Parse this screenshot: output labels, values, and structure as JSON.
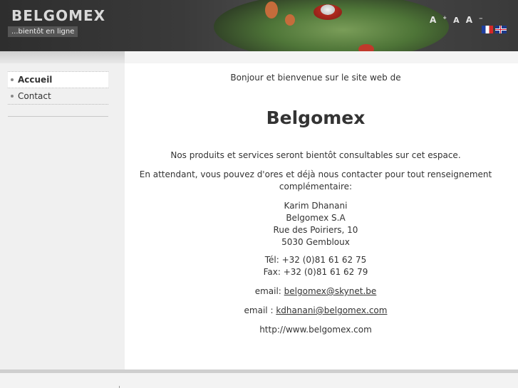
{
  "header": {
    "site_title": "BELGOMEX",
    "slogan": "...bientôt en ligne",
    "font_controls": {
      "increase": "A",
      "increase_sign": "+",
      "normal": "A",
      "decrease": "A",
      "decrease_sign": "−"
    },
    "languages": [
      "fr",
      "en"
    ]
  },
  "nav": {
    "items": [
      {
        "label": "Accueil",
        "active": true
      },
      {
        "label": "Contact",
        "active": false
      }
    ]
  },
  "content": {
    "intro": "Bonjour et bienvenue sur le site web de",
    "company": "Belgomex",
    "products": "Nos produits et services seront bientôt consultables sur cet espace.",
    "waiting": "En attendant, vous pouvez d'ores et déjà nous contacter pour tout renseignement complémentaire:",
    "address": {
      "name": "Karim Dhanani",
      "company": "Belgomex S.A",
      "street": "Rue des Poiriers, 10",
      "city": "5030 Gembloux"
    },
    "phone": "Tél: +32 (0)81 61 62 75",
    "fax": "Fax: +32 (0)81 61 62 79",
    "email1_label": "email:",
    "email1": "belgomex@skynet.be",
    "email2_label": "email :",
    "email2": "kdhanani@belgomex.com",
    "website": "http://www.belgomex.com"
  },
  "colors": {
    "header_bg": "#3a3a3a",
    "sidebar_bg": "#f0f0f0",
    "text": "#333333"
  }
}
